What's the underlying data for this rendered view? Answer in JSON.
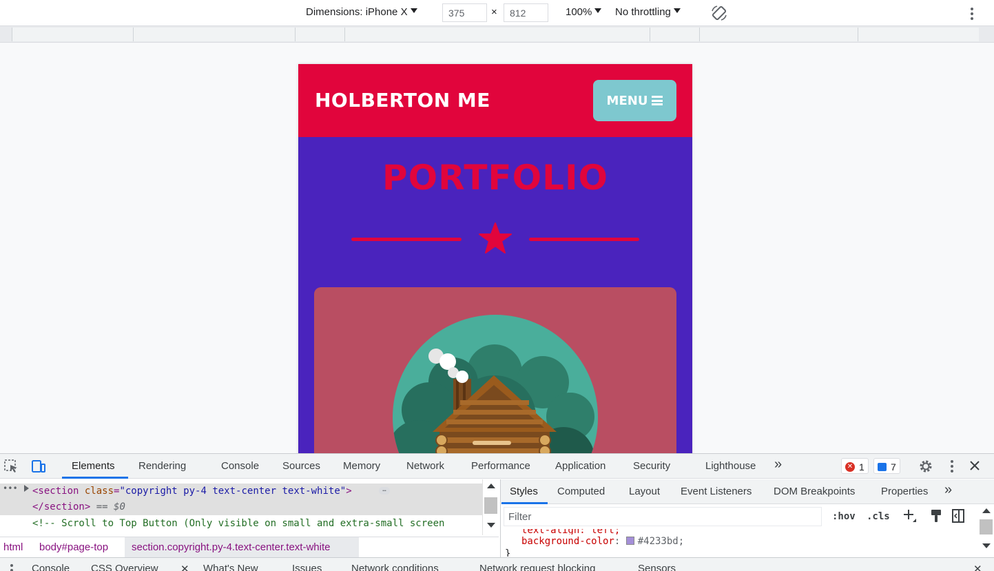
{
  "device_toolbar": {
    "dimensions_label": "Dimensions: iPhone X",
    "width_value": "375",
    "times": "×",
    "height_value": "812",
    "zoom": "100%",
    "throttling": "No throttling"
  },
  "site": {
    "brand": "HOLBERTON ME",
    "menu_label": "MENU",
    "section_title": "PORTFOLIO",
    "colors": {
      "navbar": "#e1053c",
      "page_bg": "#4a23bd",
      "menu_button": "#7ec8cf",
      "card": "#b94e62"
    }
  },
  "devtools": {
    "main_tabs": [
      "Elements",
      "Rendering",
      "Console",
      "Sources",
      "Memory",
      "Network",
      "Performance",
      "Application",
      "Security",
      "Lighthouse"
    ],
    "more_tabs": "»",
    "error_count": "1",
    "message_count": "7",
    "elements": {
      "line0_tag_open": "<section ",
      "line0_attr": "class",
      "line0_eq": "=",
      "line0_val": "\"copyright py-4 text-center text-white\"",
      "line0_close": ">",
      "line1_tag": "</section>",
      "line1_marker": "== $0",
      "line2_comment": "<!-- Scroll to Top Button (Only visible on small and extra-small screen"
    },
    "breadcrumbs": [
      "html",
      "body#page-top",
      "section.copyright.py-4.text-center.text-white"
    ],
    "styles_tabs": [
      "Styles",
      "Computed",
      "Layout",
      "Event Listeners",
      "DOM Breakpoints",
      "Properties"
    ],
    "filter_placeholder": "Filter",
    "hov": ":hov",
    "cls": ".cls",
    "css_partial": "text-align: left;",
    "css_prop_name": "background-color",
    "css_prop_value": "#4233bd;",
    "css_close": "}",
    "drawer_tabs": [
      "Console",
      "CSS Overview",
      "What's New",
      "Issues",
      "Network conditions",
      "Network request blocking",
      "Sensors"
    ]
  }
}
